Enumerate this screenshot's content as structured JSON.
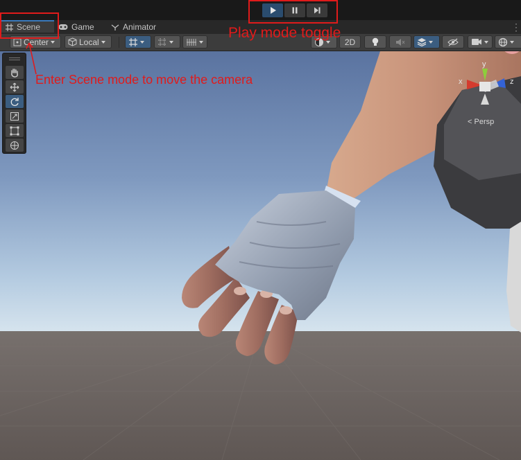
{
  "tabs": [
    {
      "label": "Scene",
      "icon": "grid-icon",
      "selected": true
    },
    {
      "label": "Game",
      "icon": "gamepad-icon",
      "selected": false
    },
    {
      "label": "Animator",
      "icon": "animator-icon",
      "selected": false
    }
  ],
  "toolbar": {
    "pivot_label": "Center",
    "space_label": "Local",
    "mode_2d_label": "2D"
  },
  "gizmo": {
    "x_label": "x",
    "y_label": "y",
    "z_label": "z",
    "view_label": "Persp"
  },
  "annotations": {
    "scene_note": "Enter Scene mode to move the camera",
    "play_note": "Play mode toggle",
    "color": "#e01b1b"
  },
  "colors": {
    "accent_blue": "#3b5d80",
    "sky_top": "#5e76a2",
    "sky_horizon": "#c9dcea",
    "ground": "#6b625f"
  }
}
